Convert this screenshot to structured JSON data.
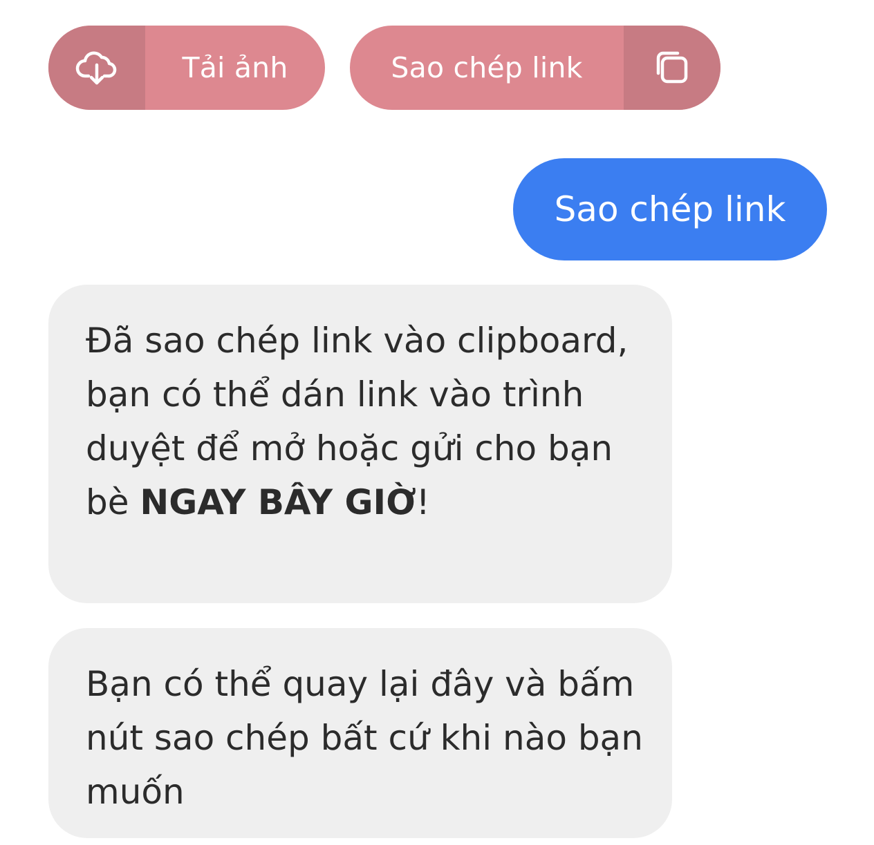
{
  "actions": {
    "download_label": "Tải ảnh",
    "copy_label": "Sao chép link",
    "download_icon": "cloud-download-icon",
    "copy_icon": "copy-icon",
    "accent_color": "#dd8890",
    "icon_segment_color": "#c77b83"
  },
  "chat": {
    "user_message": "Sao chép link",
    "user_bubble_color": "#3b7ef1",
    "bot_bubble_color": "#efefef",
    "bot_message_1": {
      "text": "Đã sao chép link vào clipboard, bạn có thể dán link vào trình duyệt để mở hoặc gửi cho bạn bè ",
      "emphasis": "NGAY BÂY GIỜ",
      "suffix": "!"
    },
    "bot_message_2": "Bạn có thể quay lại đây và bấm nút sao chép bất cứ khi nào bạn muốn"
  }
}
